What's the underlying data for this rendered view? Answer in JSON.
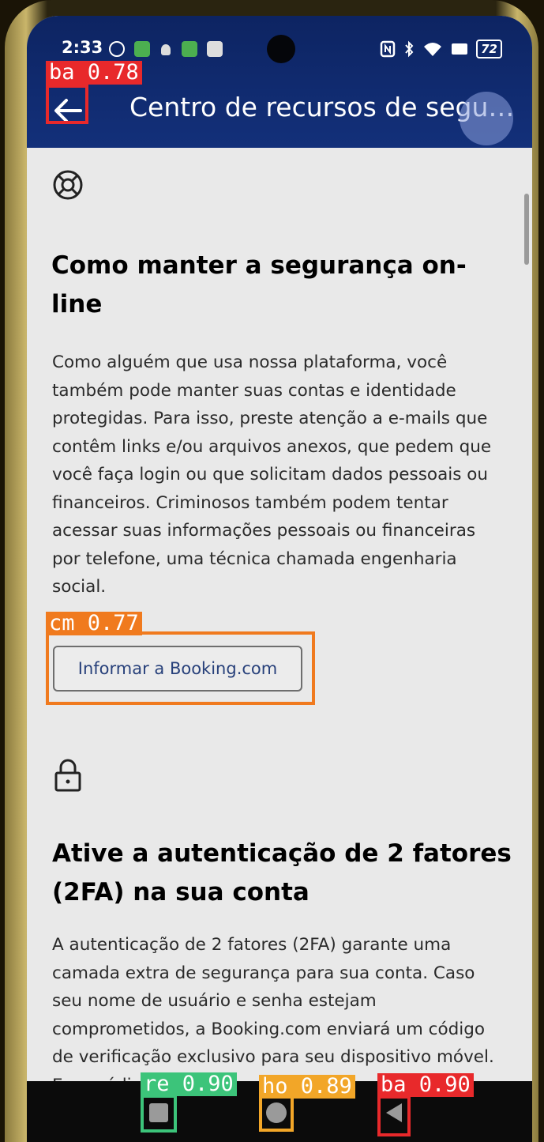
{
  "status_bar": {
    "time": "2:33",
    "battery": "72"
  },
  "appbar": {
    "title": "Centro de recursos de segura..."
  },
  "sections": [
    {
      "icon": "lifebuoy-icon",
      "heading_line1": "Como manter a segurança on-",
      "heading_line2": "line",
      "body": [
        "Como alguém que usa nossa plataforma, você",
        "também pode manter suas contas e identidade",
        "protegidas. Para isso, preste atenção a e-mails que",
        "contêm links e/ou arquivos anexos, que pedem que",
        "você faça login ou que solicitam dados pessoais ou",
        "financeiros. Criminosos também podem tentar",
        "acessar suas informações pessoais ou financeiras",
        "por telefone, uma técnica chamada engenharia",
        "social."
      ],
      "button_label": "Informar a Booking.com"
    },
    {
      "icon": "lock-icon",
      "heading_line1": "Ative a autenticação de 2 fatores",
      "heading_line2": "(2FA) na sua conta",
      "body": [
        "A autenticação de 2 fatores (2FA) garante uma",
        "camada extra de segurança para sua conta. Caso",
        "seu nome de usuário e senha estejam",
        "comprometidos, a Booking.com enviará um código",
        "de verificação exclusivo para seu dispositivo móvel.",
        "Esse código"
      ]
    }
  ],
  "detections": [
    {
      "label": "ba 0.78",
      "color": "#e8292b"
    },
    {
      "label": "cm 0.77",
      "color": "#f07a1e"
    },
    {
      "label": "re 0.90",
      "color": "#3cc47a"
    },
    {
      "label": "ho 0.89",
      "color": "#f2a628"
    },
    {
      "label": "ba 0.90",
      "color": "#e8292b"
    }
  ]
}
